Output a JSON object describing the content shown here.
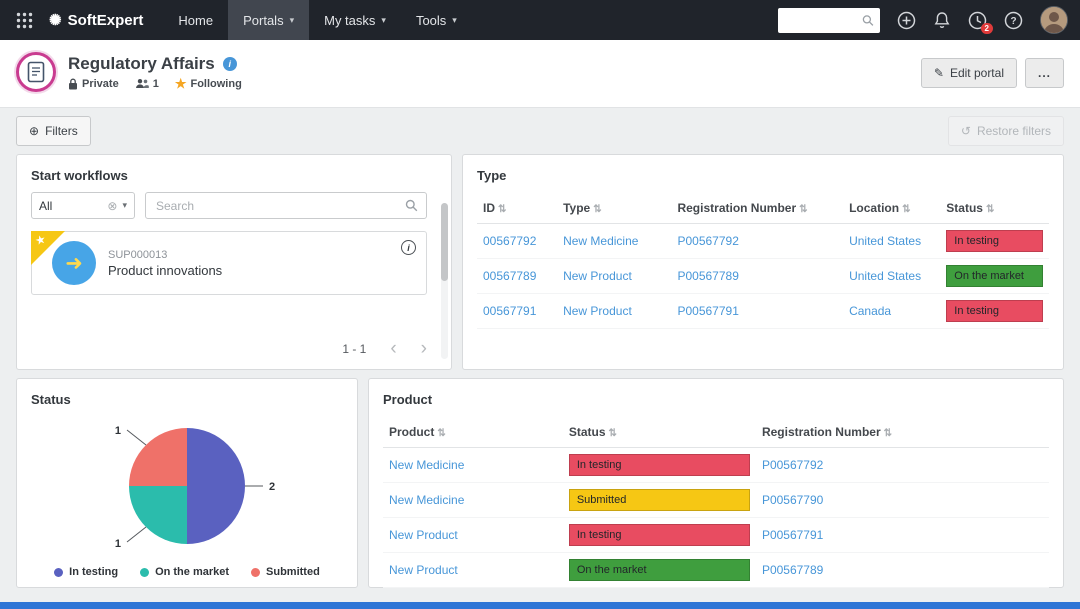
{
  "icons": {
    "logo": "✺",
    "caret_down": "▾",
    "sort": "⇅",
    "clear": "⊗",
    "star": "★",
    "corner_star": "★",
    "pencil": "✎",
    "filters_plus": "⊕",
    "restore": "↺",
    "chev_left": "‹",
    "chev_right": "›",
    "workflow_arrow": "➜",
    "info": "i"
  },
  "navbar": {
    "brand": "SoftExpert",
    "items": [
      {
        "label": "Home"
      },
      {
        "label": "Portals"
      },
      {
        "label": "My tasks"
      },
      {
        "label": "Tools"
      }
    ],
    "notification_badge": "2"
  },
  "header": {
    "title": "Regulatory Affairs",
    "privacy_label": "Private",
    "members_count": "1",
    "following_label": "Following",
    "edit_portal_label": "Edit portal",
    "more_label": "..."
  },
  "filters_bar": {
    "filters_label": "Filters",
    "restore_label": "Restore filters"
  },
  "start_workflows": {
    "title": "Start workflows",
    "filter_value": "All",
    "search_placeholder": "Search",
    "workflow": {
      "code": "SUP000013",
      "name": "Product innovations"
    },
    "pagination": "1 - 1"
  },
  "type_widget": {
    "title": "Type",
    "columns": [
      "ID",
      "Type",
      "Registration Number",
      "Location",
      "Status"
    ],
    "rows": [
      {
        "id": "00567792",
        "type": "New Medicine",
        "registration_number": "P00567792",
        "location": "United States",
        "status": "In testing",
        "status_color": "#e84c61"
      },
      {
        "id": "00567789",
        "type": "New Product",
        "registration_number": "P00567789",
        "location": "United States",
        "status": "On the market",
        "status_color": "#3f9e3e"
      },
      {
        "id": "00567791",
        "type": "New Product",
        "registration_number": "P00567791",
        "location": "Canada",
        "status": "In testing",
        "status_color": "#e84c61"
      }
    ]
  },
  "status_widget": {
    "title": "Status"
  },
  "product_widget": {
    "title": "Product",
    "columns": [
      "Product",
      "Status",
      "Registration Number"
    ],
    "rows": [
      {
        "product": "New Medicine",
        "status": "In testing",
        "status_color": "#e84c61",
        "registration_number": "P00567792"
      },
      {
        "product": "New Medicine",
        "status": "Submitted",
        "status_color": "#f6c714",
        "registration_number": "P00567790"
      },
      {
        "product": "New Product",
        "status": "In testing",
        "status_color": "#e84c61",
        "registration_number": "P00567791"
      },
      {
        "product": "New Product",
        "status": "On the market",
        "status_color": "#3f9e3e",
        "registration_number": "P00567789"
      }
    ]
  },
  "chart_data": {
    "type": "pie",
    "title": "Status",
    "slices": [
      {
        "label": "In testing",
        "value": 2,
        "color": "#5a61c0"
      },
      {
        "label": "On the market",
        "value": 1,
        "color": "#2bbcac"
      },
      {
        "label": "Submitted",
        "value": 1,
        "color": "#ef7169"
      }
    ],
    "legend_position": "bottom"
  }
}
